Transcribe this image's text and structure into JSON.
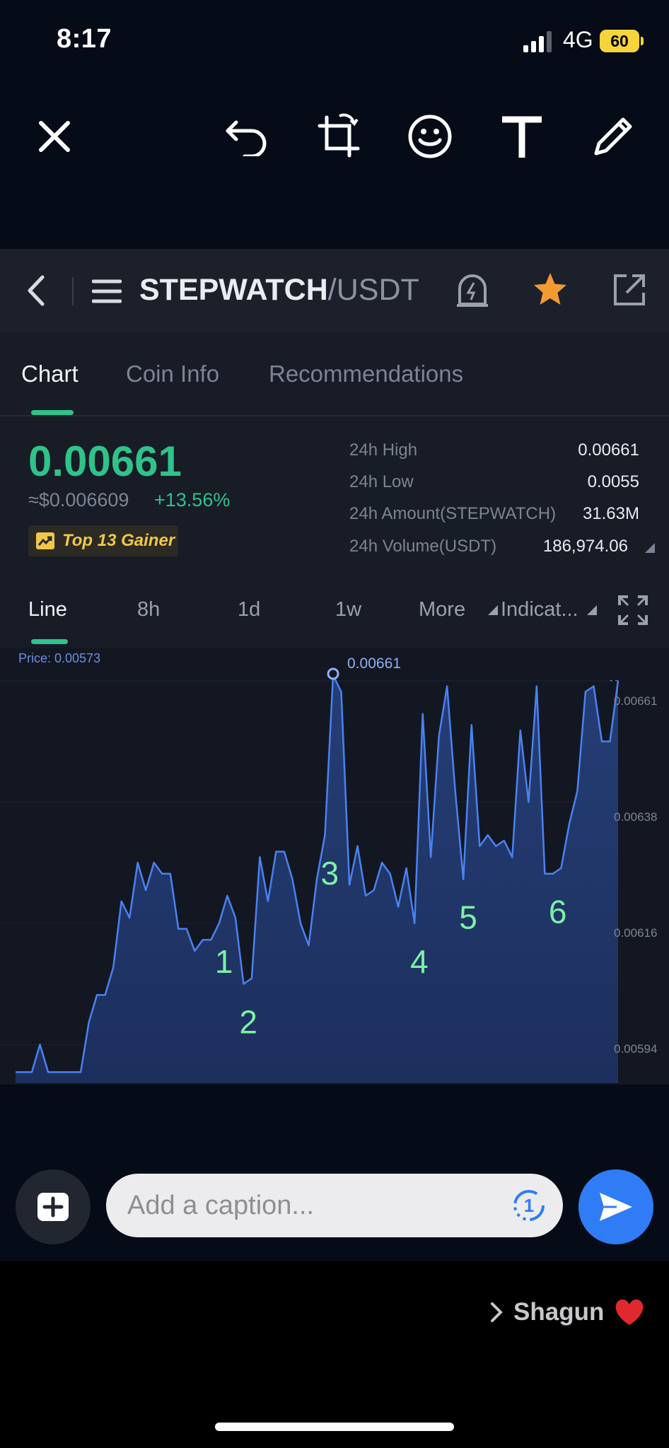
{
  "status_bar": {
    "time": "8:17",
    "network": "4G",
    "battery": "60"
  },
  "toolbar": {
    "icons": [
      "close-icon",
      "undo-icon",
      "crop-rotate-icon",
      "emoji-icon",
      "text-icon",
      "pencil-icon"
    ]
  },
  "header": {
    "pair_base": "STEPWATCH",
    "pair_quote": "/USDT"
  },
  "tabs": [
    {
      "label": "Chart"
    },
    {
      "label": "Coin Info"
    },
    {
      "label": "Recommendations"
    }
  ],
  "ticker": {
    "price": "0.00661",
    "fiat": "≈$0.006609",
    "change": "+13.56%",
    "badge": "Top 13 Gainer",
    "stats": [
      {
        "label": "24h High",
        "value": "0.00661"
      },
      {
        "label": "24h Low",
        "value": "0.0055"
      },
      {
        "label": "24h Amount(STEPWATCH)",
        "value": "31.63M"
      },
      {
        "label": "24h Volume(USDT)",
        "value": "186,974.06"
      }
    ]
  },
  "timeframes": [
    {
      "label": "Line"
    },
    {
      "label": "8h"
    },
    {
      "label": "1d"
    },
    {
      "label": "1w"
    },
    {
      "label": "More"
    },
    {
      "label": "Indicat..."
    }
  ],
  "chart_data": {
    "type": "area",
    "price_label": "Price: 0.00573",
    "y_ticks": [
      "0.00661",
      "0.00638",
      "0.00616",
      "0.00594"
    ],
    "y_tick_values": [
      0.0066,
      0.00638,
      0.00616,
      0.00594
    ],
    "ylim": [
      0.00587,
      0.00666
    ],
    "max_label": "0.00661",
    "max_value": 0.00661,
    "values": [
      0.00589,
      0.00589,
      0.00589,
      0.00594,
      0.00589,
      0.00589,
      0.00589,
      0.00589,
      0.00589,
      0.00598,
      0.00603,
      0.00603,
      0.00608,
      0.0062,
      0.00617,
      0.00627,
      0.00622,
      0.00627,
      0.00625,
      0.00625,
      0.00615,
      0.00615,
      0.00611,
      0.00613,
      0.00613,
      0.00616,
      0.00621,
      0.00617,
      0.00605,
      0.00606,
      0.00628,
      0.0062,
      0.00629,
      0.00629,
      0.00624,
      0.00616,
      0.00612,
      0.00624,
      0.00632,
      0.00661,
      0.00658,
      0.00623,
      0.0063,
      0.00621,
      0.00622,
      0.00627,
      0.00625,
      0.00619,
      0.00626,
      0.00616,
      0.00654,
      0.00628,
      0.0065,
      0.00659,
      0.0064,
      0.00624,
      0.00652,
      0.0063,
      0.00632,
      0.0063,
      0.00631,
      0.00628,
      0.00651,
      0.00638,
      0.00659,
      0.00625,
      0.00625,
      0.00626,
      0.00634,
      0.0064,
      0.00658,
      0.00659,
      0.00649,
      0.00649,
      0.0066
    ],
    "annotations": [
      {
        "text": "1",
        "at": 25
      },
      {
        "text": "2",
        "at": 28
      },
      {
        "text": "3",
        "at": 38
      },
      {
        "text": "4",
        "at": 49
      },
      {
        "text": "5",
        "at": 55
      },
      {
        "text": "6",
        "at": 66
      }
    ]
  },
  "caption": {
    "placeholder": "Add a caption...",
    "view_once": "1"
  },
  "recipient": {
    "name": "Shagun"
  }
}
